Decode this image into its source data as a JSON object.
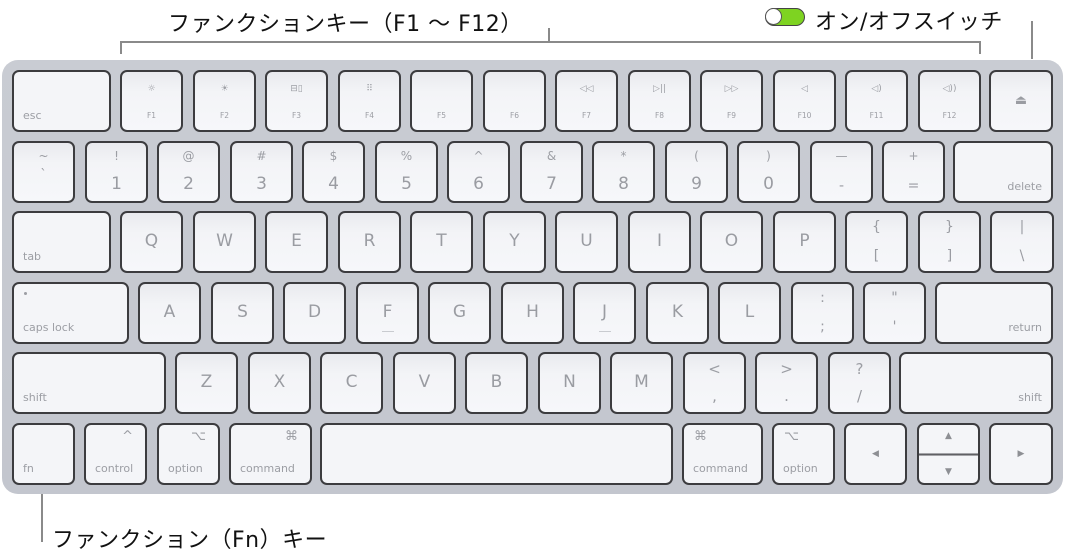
{
  "callouts": {
    "function_keys": "ファンクションキー（F1 〜 F12）",
    "power_switch": "オン/オフスイッチ",
    "fn_key": "ファンクション（Fn）キー"
  },
  "toggle": {
    "state": "on",
    "color": "#7ed321"
  },
  "keyboard": {
    "row1": {
      "esc": "esc",
      "fkeys": [
        {
          "label": "F1",
          "icon": "brightness-down-icon",
          "glyph": "☼"
        },
        {
          "label": "F2",
          "icon": "brightness-up-icon",
          "glyph": "☀"
        },
        {
          "label": "F3",
          "icon": "mission-control-icon",
          "glyph": "⊟▯"
        },
        {
          "label": "F4",
          "icon": "launchpad-icon",
          "glyph": "⠿"
        },
        {
          "label": "F5",
          "icon": "",
          "glyph": ""
        },
        {
          "label": "F6",
          "icon": "",
          "glyph": ""
        },
        {
          "label": "F7",
          "icon": "rewind-icon",
          "glyph": "◁◁"
        },
        {
          "label": "F8",
          "icon": "play-pause-icon",
          "glyph": "▷||"
        },
        {
          "label": "F9",
          "icon": "fast-forward-icon",
          "glyph": "▷▷"
        },
        {
          "label": "F10",
          "icon": "mute-icon",
          "glyph": "◁"
        },
        {
          "label": "F11",
          "icon": "volume-down-icon",
          "glyph": "◁)"
        },
        {
          "label": "F12",
          "icon": "volume-up-icon",
          "glyph": "◁))"
        }
      ],
      "eject_glyph": "⏏"
    },
    "row2": {
      "keys": [
        {
          "top": "~",
          "bot": "`"
        },
        {
          "top": "!",
          "bot": "1"
        },
        {
          "top": "@",
          "bot": "2"
        },
        {
          "top": "#",
          "bot": "3"
        },
        {
          "top": "$",
          "bot": "4"
        },
        {
          "top": "%",
          "bot": "5"
        },
        {
          "top": "^",
          "bot": "6"
        },
        {
          "top": "&",
          "bot": "7"
        },
        {
          "top": "*",
          "bot": "8"
        },
        {
          "top": "(",
          "bot": "9"
        },
        {
          "top": ")",
          "bot": "0"
        },
        {
          "top": "—",
          "bot": "-"
        },
        {
          "top": "+",
          "bot": "="
        }
      ],
      "delete": "delete"
    },
    "row3": {
      "tab": "tab",
      "letters": [
        "Q",
        "W",
        "E",
        "R",
        "T",
        "Y",
        "U",
        "I",
        "O",
        "P"
      ],
      "brackets": [
        {
          "top": "{",
          "bot": "["
        },
        {
          "top": "}",
          "bot": "]"
        },
        {
          "top": "|",
          "bot": "\\"
        }
      ]
    },
    "row4": {
      "caps": "caps lock",
      "letters": [
        "A",
        "S",
        "D",
        "F",
        "G",
        "H",
        "J",
        "K",
        "L"
      ],
      "punct": [
        {
          "top": ":",
          "bot": ";"
        },
        {
          "top": "\"",
          "bot": "'"
        }
      ],
      "return": "return"
    },
    "row5": {
      "shift_left": "shift",
      "letters": [
        "Z",
        "X",
        "C",
        "V",
        "B",
        "N",
        "M"
      ],
      "punct": [
        {
          "top": "<",
          "bot": ","
        },
        {
          "top": ">",
          "bot": "."
        },
        {
          "top": "?",
          "bot": "/"
        }
      ],
      "shift_right": "shift"
    },
    "row6": {
      "fn": "fn",
      "control": "control",
      "control_glyph": "^",
      "option": "option",
      "option_glyph": "⌥",
      "command": "command",
      "command_glyph": "⌘",
      "left_arrow": "◀",
      "up_arrow": "▲",
      "down_arrow": "▼",
      "right_arrow": "▶"
    }
  }
}
